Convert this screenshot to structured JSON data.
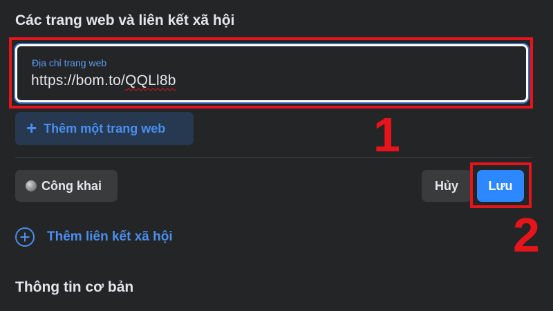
{
  "section": {
    "title": "Các trang web và liên kết xã hội"
  },
  "website_field": {
    "label": "Địa chỉ trang web",
    "value_prefix": "https://bom.to/",
    "value_misspelled": "QQLl8b"
  },
  "add_website": {
    "label": "Thêm một trang web",
    "icon": "plus-icon"
  },
  "privacy": {
    "label": "Công khai",
    "icon": "globe-icon"
  },
  "actions": {
    "cancel_label": "Hủy",
    "save_label": "Lưu"
  },
  "add_social": {
    "label": "Thêm liên kết xã hội",
    "icon": "circle-plus-icon"
  },
  "basic_info": {
    "title": "Thông tin cơ bản"
  },
  "annotations": {
    "step1": "1",
    "step2": "2",
    "color": "#e8141b"
  },
  "colors": {
    "background": "#242526",
    "accent": "#2d88ff",
    "link": "#4a8ff0"
  }
}
